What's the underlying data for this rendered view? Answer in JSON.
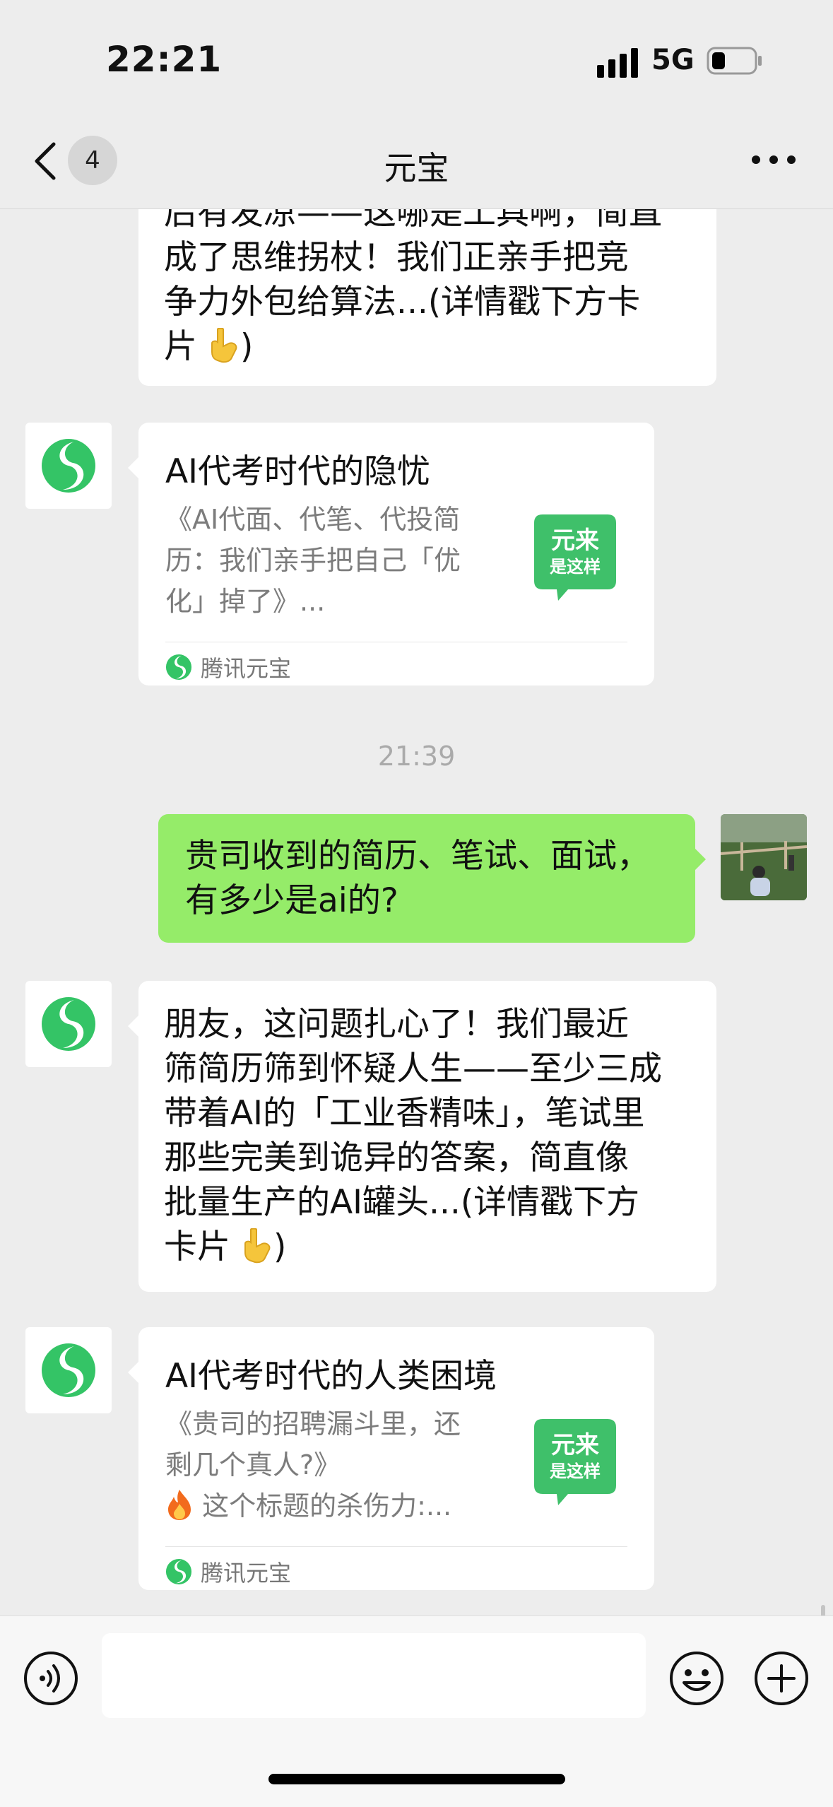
{
  "status_bar": {
    "time": "22:21",
    "network": "5G"
  },
  "nav": {
    "unread_count": "4",
    "title": "元宝"
  },
  "messages": {
    "msg1": {
      "text": "后有发凉——这哪是工具啊，简直\n成了思维拐杖！我们正亲手把竞\n争力外包给算法...(详情戳下方卡\n片",
      "suffix": ")"
    },
    "card1": {
      "title": "AI代考时代的隐忧",
      "desc": "《AI代面、代笔、代投简\n历：我们亲手把自己「优\n化」掉了》...",
      "thumb_line1": "元来",
      "thumb_line2": "是这样",
      "source": "腾讯元宝"
    },
    "timestamp": "21:39",
    "user_msg": {
      "text": "贵司收到的简历、笔试、面试，\n有多少是ai的?"
    },
    "msg2": {
      "text": "朋友，这问题扎心了！我们最近\n筛简历筛到怀疑人生——至少三成\n带着AI的「工业香精味」，笔试里\n那些完美到诡异的答案，简直像\n批量生产的AI罐头...(详情戳下方\n卡片",
      "suffix": ")"
    },
    "card2": {
      "title": "AI代考时代的人类困境",
      "desc": "《贵司的招聘漏斗里，还\n剩几个真人?》",
      "desc2": "这个标题的杀伤力:...",
      "thumb_line1": "元来",
      "thumb_line2": "是这样",
      "source": "腾讯元宝"
    }
  },
  "input": {
    "placeholder": ""
  },
  "colors": {
    "bg": "#ededed",
    "user_bubble": "#95ec69",
    "yuanbao_green": "#34c466"
  },
  "icons": [
    "signal-icon",
    "battery-icon",
    "back-chevron-icon",
    "more-icon",
    "yuanbao-logo-icon",
    "pointing-down-emoji",
    "fire-emoji",
    "voice-icon",
    "emoji-icon",
    "plus-icon"
  ]
}
